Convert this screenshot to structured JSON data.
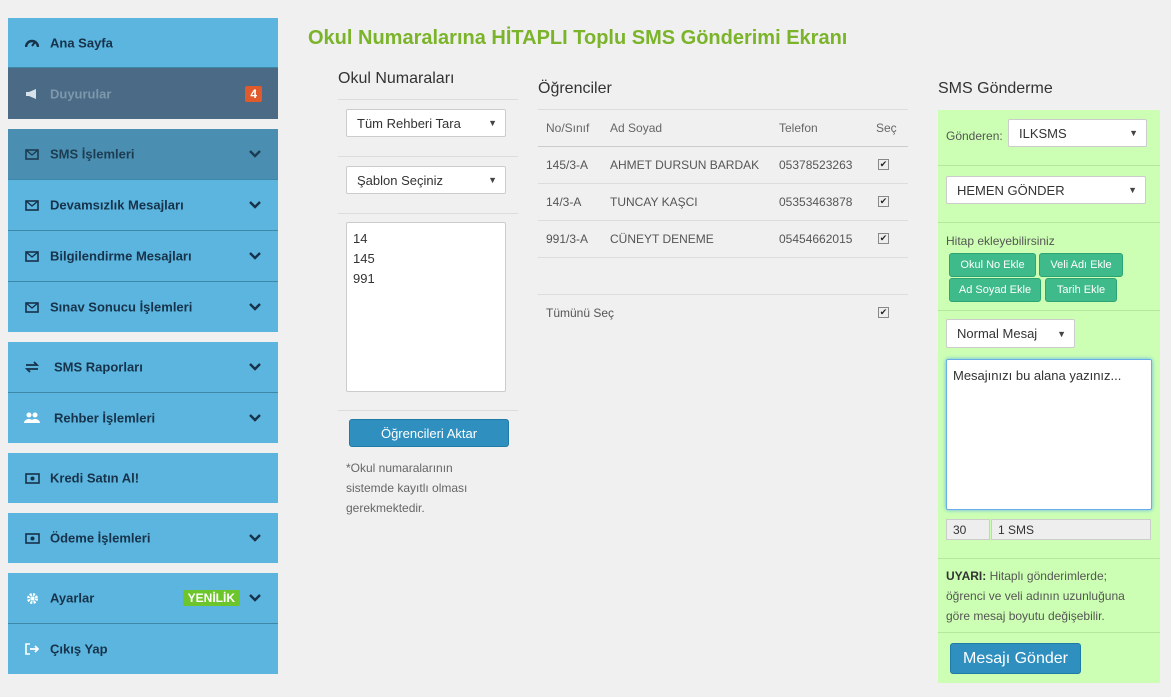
{
  "sidebar": {
    "home": "Ana Sayfa",
    "announcements": "Duyurular",
    "announcements_badge": "4",
    "sms_ops": "SMS İşlemleri",
    "absence": "Devamsızlık Mesajları",
    "info": "Bilgilendirme Mesajları",
    "exam": "Sınav Sonucu İşlemleri",
    "reports": "SMS Raporları",
    "contacts": "Rehber İşlemleri",
    "buy_credit": "Kredi Satın Al!",
    "payments": "Ödeme İşlemleri",
    "settings": "Ayarlar",
    "settings_badge": "YENİLİK",
    "logout": "Çıkış Yap"
  },
  "page_title": "Okul Numaralarına HİTAPLI Toplu SMS Gönderimi Ekranı",
  "left": {
    "heading": "Okul Numaraları",
    "contacts_select": "Tüm Rehberi Tara",
    "template_select": "Şablon Seçiniz",
    "numbers": "14\n145\n991",
    "transfer_button": "Öğrencileri Aktar",
    "note": "*Okul numaralarının sistemde kayıtlı olması gerekmektedir."
  },
  "students": {
    "heading": "Öğrenciler",
    "columns": [
      "No/Sınıf",
      "Ad Soyad",
      "Telefon",
      "Seç"
    ],
    "rows": [
      {
        "no": "145/3-A",
        "name": "AHMET DURSUN BARDAK",
        "phone": "05378523263"
      },
      {
        "no": "14/3-A",
        "name": "TUNCAY KAŞCI",
        "phone": "05353463878"
      },
      {
        "no": "991/3-A",
        "name": "CÜNEYT DENEME",
        "phone": "05454662015"
      }
    ],
    "select_all": "Tümünü Seç"
  },
  "sms": {
    "heading": "SMS Gönderme",
    "sender_label": "Gönderen:",
    "sender_value": "ILKSMS",
    "timing_value": "HEMEN GÖNDER",
    "salutation_hint": "Hitap ekleyebilirsiniz",
    "buttons": [
      "Okul No Ekle",
      "Veli Adı Ekle",
      "Ad Soyad Ekle",
      "Tarih Ekle"
    ],
    "message_type": "Normal Mesaj",
    "message_placeholder": "Mesajınızı bu alana yazınız...",
    "char_count": "30",
    "sms_count": "1 SMS",
    "warning_label": "UYARI:",
    "warning_text": "Hitaplı gönderimlerde; öğrenci ve veli adının uzunluğuna göre mesaj boyutu değişebilir.",
    "send_button": "Mesajı Gönder"
  },
  "colors": {
    "sidebar": "#5bb5de",
    "title": "#7bb42a",
    "sms_panel": "#ccffb3",
    "action_green": "#3fba8a",
    "badge": "#e05a2b",
    "new_badge": "#6cc52a"
  }
}
